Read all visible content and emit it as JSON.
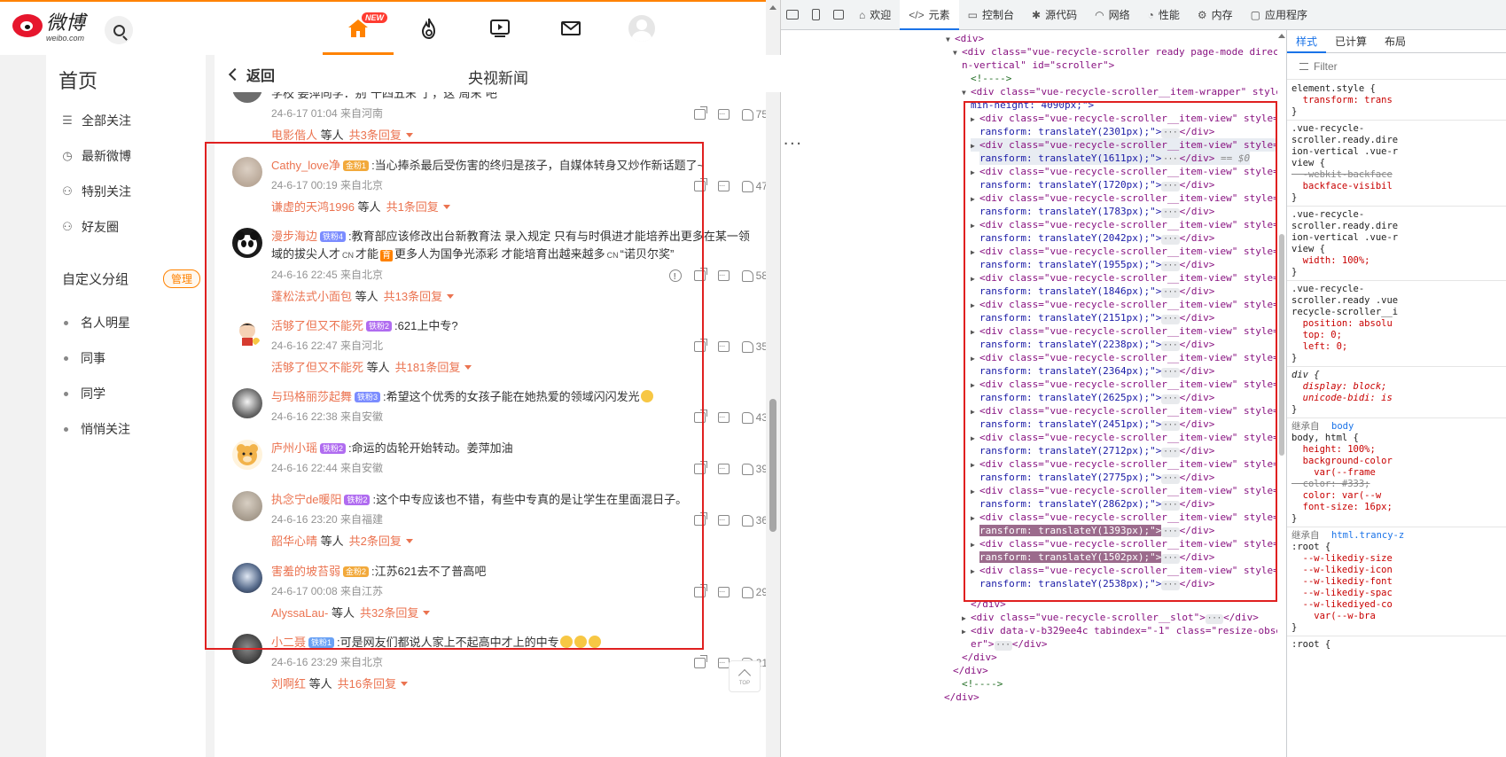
{
  "weibo": {
    "logo": {
      "zh": "微博",
      "en": "weibo.com"
    },
    "nav": {
      "new_badge": "NEW"
    },
    "sidebar": {
      "title": "首页",
      "nav": [
        {
          "label": "全部关注",
          "icon": "list-icon"
        },
        {
          "label": "最新微博",
          "icon": "clock-icon"
        },
        {
          "label": "特别关注",
          "icon": "user-star-icon"
        },
        {
          "label": "好友圈",
          "icon": "user-group-icon"
        }
      ],
      "group_title": "自定义分组",
      "manage": "管理",
      "groups": [
        "名人明星",
        "同事",
        "同学",
        "悄悄关注"
      ]
    },
    "main": {
      "back": "返回",
      "title": "央视新闻",
      "comments": [
        {
          "text": "学校 姜萍同学：别“十四五末”了，这“周末”吧",
          "meta": "24-6-17 01:04 来自河南",
          "likes": "75",
          "reply_user": "电影偕人",
          "reply_mid": "等人",
          "reply_count": "共3条回复"
        },
        {
          "user": "Cathy_love净",
          "badge": "金粉1",
          "text": ":当心捧杀最后受伤害的终归是孩子，自媒体转身又炒作新话题了~",
          "meta": "24-6-17 00:19 来自北京",
          "likes": "47",
          "reply_user": "谦虚的天鸿1996",
          "reply_mid": "等人",
          "reply_count": "共1条回复"
        },
        {
          "user": "漫步海边",
          "badge": "铁粉4",
          "text_1": ":教育部应该修改出台新教育法 录入规定 只有与时俱进才能培养出更多在某一领",
          "text_2a": "域的拔尖人才",
          "text_2b": "才能",
          "text_2c": "更多人为国争光添彩 才能培育出越来越多",
          "text_2d": "“诺贝尔奖”",
          "cn": "CN",
          "meta": "24-6-16 22:45 来自北京",
          "likes": "58",
          "reply_user": "蓬松法式小面包",
          "reply_mid": "等人",
          "reply_count": "共13条回复"
        },
        {
          "user": "活够了但又不能死",
          "badge": "铁粉2",
          "text": ":621上中专?",
          "meta": "24-6-16 22:47 来自河北",
          "likes": "35",
          "reply_user": "活够了但又不能死",
          "reply_mid": "等人",
          "reply_count": "共181条回复"
        },
        {
          "user": "与玛格丽莎起舞",
          "badge": "铁粉3",
          "text": ":希望这个优秀的女孩子能在她热爱的领域闪闪发光",
          "meta": "24-6-16 22:38 来自安徽",
          "likes": "43"
        },
        {
          "user": "庐州小瑶",
          "badge": "铁粉2",
          "text": ":命运的齿轮开始转动。姜萍加油",
          "meta": "24-6-16 22:44 来自安徽",
          "likes": "39"
        },
        {
          "user": "执念宁de暖阳",
          "badge": "铁粉2",
          "text": ":这个中专应该也不错，有些中专真的是让学生在里面混日子。",
          "meta": "24-6-16 23:20 来自福建",
          "likes": "36",
          "reply_user": "韶华心晴",
          "reply_mid": "等人",
          "reply_count": "共2条回复"
        },
        {
          "user": "害羞的坡苔弱",
          "badge": "金粉2",
          "text": ":江苏621去不了普高吧",
          "meta": "24-6-17 00:08 来自江苏",
          "likes": "29",
          "reply_user": "AlyssaLau-",
          "reply_mid": "等人",
          "reply_count": "共32条回复"
        },
        {
          "user": "小二聂",
          "badge": "铁粉1",
          "text": ":可是网友们都说人家上不起高中才上的中专",
          "meta": "24-6-16 23:29 来自北京",
          "likes": "21",
          "reply_user": "刘啊红",
          "reply_mid": "等人",
          "reply_count": "共16条回复"
        }
      ],
      "top_label": "TOP"
    }
  },
  "devtools": {
    "tabs": [
      {
        "label": "欢迎",
        "icon": "home-icon"
      },
      {
        "label": "元素",
        "icon": "code-icon"
      },
      {
        "label": "控制台",
        "icon": "console-icon"
      },
      {
        "label": "源代码",
        "icon": "bug-icon"
      },
      {
        "label": "网络",
        "icon": "wifi-icon"
      },
      {
        "label": "性能",
        "icon": "gauge-icon"
      },
      {
        "label": "内存",
        "icon": "gear-icon"
      },
      {
        "label": "应用程序",
        "icon": "window-icon"
      }
    ],
    "dom": {
      "line_div_open": "<div>",
      "scroller_open_1": "<div class=\"vue-recycle-scroller ready page-mode directio",
      "scroller_open_2": "n-vertical\" id=\"scroller\">",
      "comment": "<!---->",
      "wrapper_1": "<div class=\"vue-recycle-scroller__item-wrapper\" style=",
      "wrapper_2": "min-height: 4090px;\">",
      "item_prefix": "<div class=\"vue-recycle-scroller__item-view\" style=\"t",
      "item_prefix_alt": "<div class=\"vue-recycle-scroller__item-view\" style=\"",
      "item_transforms": [
        "2301px",
        "1611px",
        "1720px",
        "1783px",
        "2042px",
        "1955px",
        "1846px",
        "2151px",
        "2238px",
        "2364px",
        "2625px",
        "2451px",
        "2712px",
        "2775px",
        "2862px",
        "1393px",
        "1502px",
        "2538px"
      ],
      "item_suffix": ");\">",
      "item_close": "</div>",
      "eq_marker": "== $0",
      "close_div": "</div>",
      "slot_line": "<div class=\"vue-recycle-scroller__slot\">",
      "resize_line_1": "<div data-v-b329ee4c tabindex=\"-1\" class=\"resize-observ",
      "resize_line_2": "er\">",
      "transform_prefix": "ransform: translateY("
    },
    "styles": {
      "tabs": [
        "样式",
        "已计算",
        "布局"
      ],
      "filter": "Filter",
      "lines": [
        "element.style {",
        "  transform: trans",
        "}",
        ".vue-recycle-",
        "scroller.ready.dire",
        "ion-vertical .vue-r",
        "view {",
        "  -webkit-backface",
        "  backface-visibil",
        "}",
        ".vue-recycle-",
        "scroller.ready.dire",
        "ion-vertical .vue-r",
        "view {",
        "  width: 100%;",
        "}",
        ".vue-recycle-",
        "scroller.ready .vue",
        "recycle-scroller__i",
        "  position: absolu",
        "  top: 0;",
        "  left: 0;",
        "}",
        "div {",
        "  display: block;",
        "  unicode-bidi: is",
        "}",
        "继承自",
        "body",
        "body, html {",
        "  height: 100%;",
        "  background-color",
        "    var(--frame",
        "  color: #333;",
        "  color: var(--w",
        "  font-size: 16px;",
        "}",
        "继承自",
        "html.trancy-z",
        ":root {",
        "  --w-likediy-size",
        "  --w-likediy-icon",
        "  --w-likediy-font",
        "  --w-likediy-spac",
        "  --w-likediyed-co",
        "    var(--w-bra",
        "}",
        ":root {"
      ]
    }
  }
}
